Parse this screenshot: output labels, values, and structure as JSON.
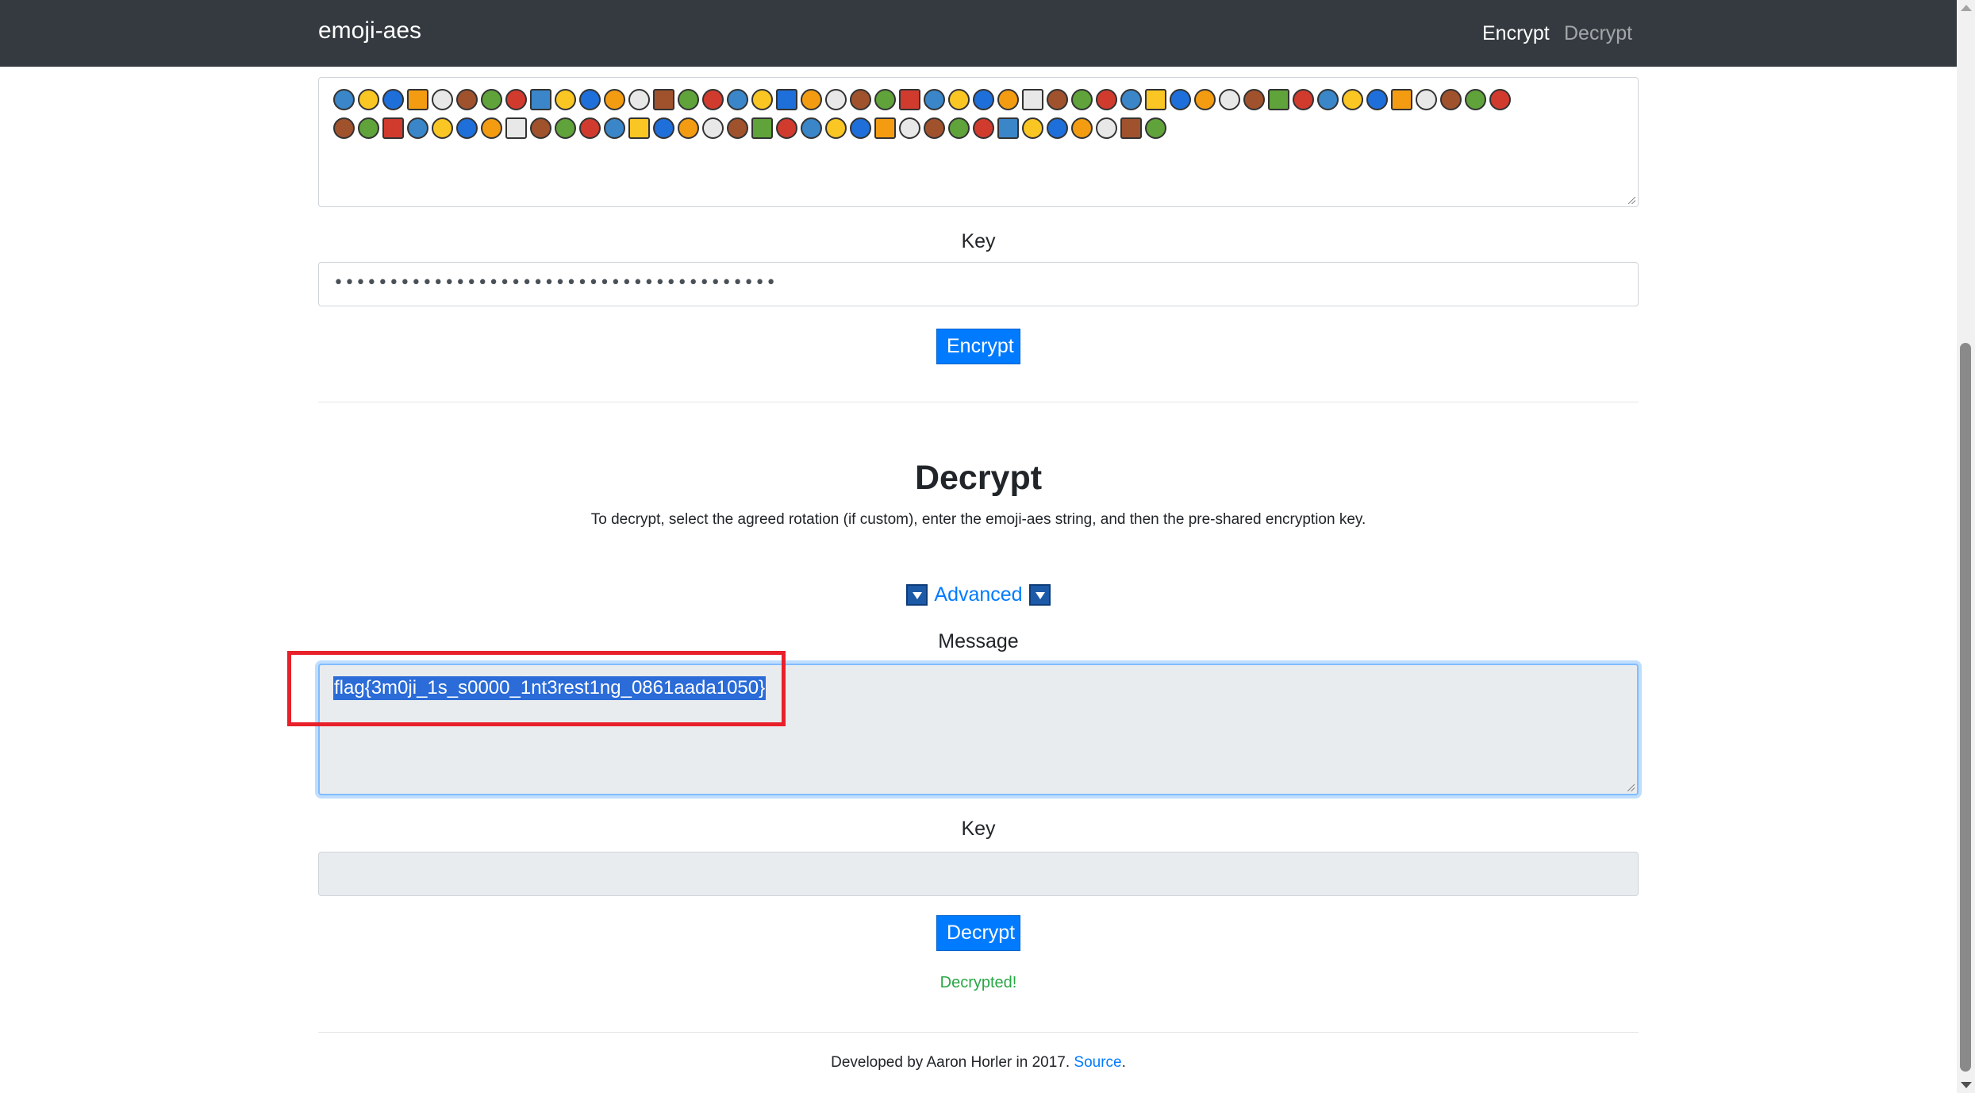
{
  "navbar": {
    "brand": "emoji-aes",
    "links": [
      "Encrypt",
      "Decrypt"
    ]
  },
  "encrypt": {
    "output_emoji_count_line1": 48,
    "output_emoji_count_line2": 34,
    "key_label": "Key",
    "key_value": "••••••••••••••••••••••••••••••••••••••••",
    "button_label": "Encrypt"
  },
  "decrypt": {
    "title": "Decrypt",
    "description": "To decrypt, select the agreed rotation (if custom), enter the emoji-aes string, and then the pre-shared encryption key.",
    "advanced_label": "Advanced",
    "message_label": "Message",
    "message_value": "flag{3m0ji_1s_s0000_1nt3rest1ng_0861aada1050}",
    "key_label": "Key",
    "key_value": "",
    "button_label": "Decrypt",
    "status": "Decrypted!"
  },
  "footer": {
    "text": "Developed by Aaron Horler in 2017.",
    "link": "Source",
    "trailing": "."
  },
  "colors": {
    "navbar_bg": "#343a40",
    "primary": "#007bff",
    "success": "#28a745",
    "annotation_red": "#e8202a"
  }
}
